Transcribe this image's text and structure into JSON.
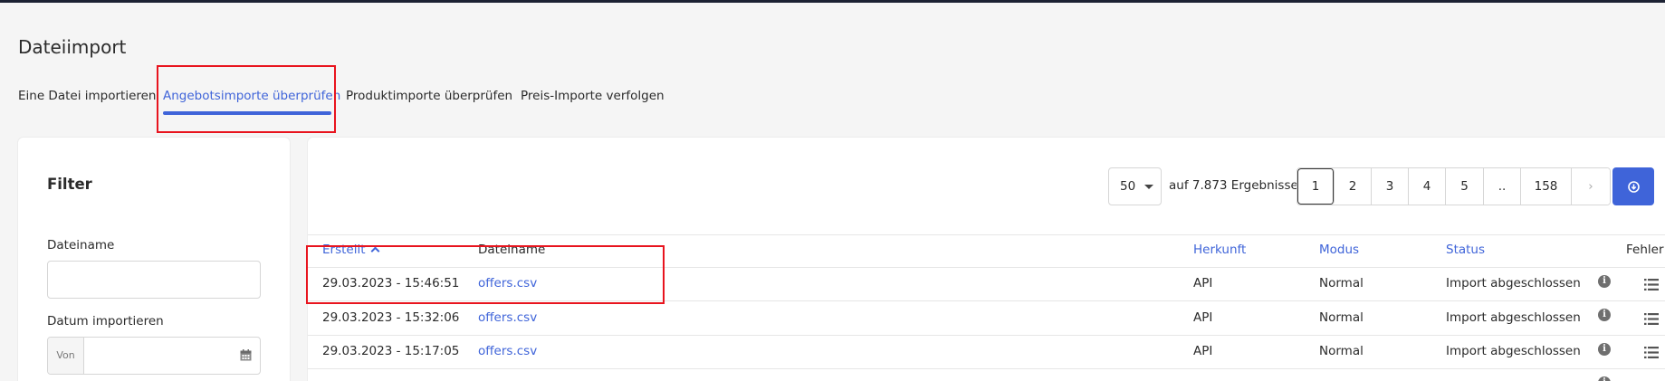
{
  "page": {
    "title": "Dateiimport"
  },
  "tabs": [
    {
      "label": "Eine Datei importieren"
    },
    {
      "label": "Angebotsimporte überprüfen"
    },
    {
      "label": "Produktimporte überprüfen"
    },
    {
      "label": "Preis-Importe verfolgen"
    }
  ],
  "filter": {
    "title": "Filter",
    "filename_label": "Dateiname",
    "filename_value": "",
    "date_label": "Datum importieren",
    "date_from_prefix": "Von",
    "date_from_value": ""
  },
  "results": {
    "per_page": "50",
    "count_text": "auf 7.873 Ergebnisse",
    "pages": [
      "1",
      "2",
      "3",
      "4",
      "5",
      "..",
      "158"
    ],
    "current_page": "1",
    "next_symbol": "›"
  },
  "table": {
    "columns": {
      "created": "Erstellt",
      "filename": "Dateiname",
      "origin": "Herkunft",
      "mode": "Modus",
      "status": "Status",
      "errors": "Fehler"
    },
    "rows": [
      {
        "created": "29.03.2023 - 15:46:51",
        "filename": "offers.csv",
        "origin": "API",
        "mode": "Normal",
        "status": "Import abgeschlossen"
      },
      {
        "created": "29.03.2023 - 15:32:06",
        "filename": "offers.csv",
        "origin": "API",
        "mode": "Normal",
        "status": "Import abgeschlossen"
      },
      {
        "created": "29.03.2023 - 15:17:05",
        "filename": "offers.csv",
        "origin": "API",
        "mode": "Normal",
        "status": "Import abgeschlossen"
      }
    ]
  },
  "colors": {
    "accent": "#3f64d9",
    "highlight": "#e8141e"
  },
  "icons": {
    "sort": "chevron-up-icon",
    "info": "info-icon",
    "errors": "list-icon",
    "calendar": "calendar-icon",
    "download": "download-icon"
  }
}
